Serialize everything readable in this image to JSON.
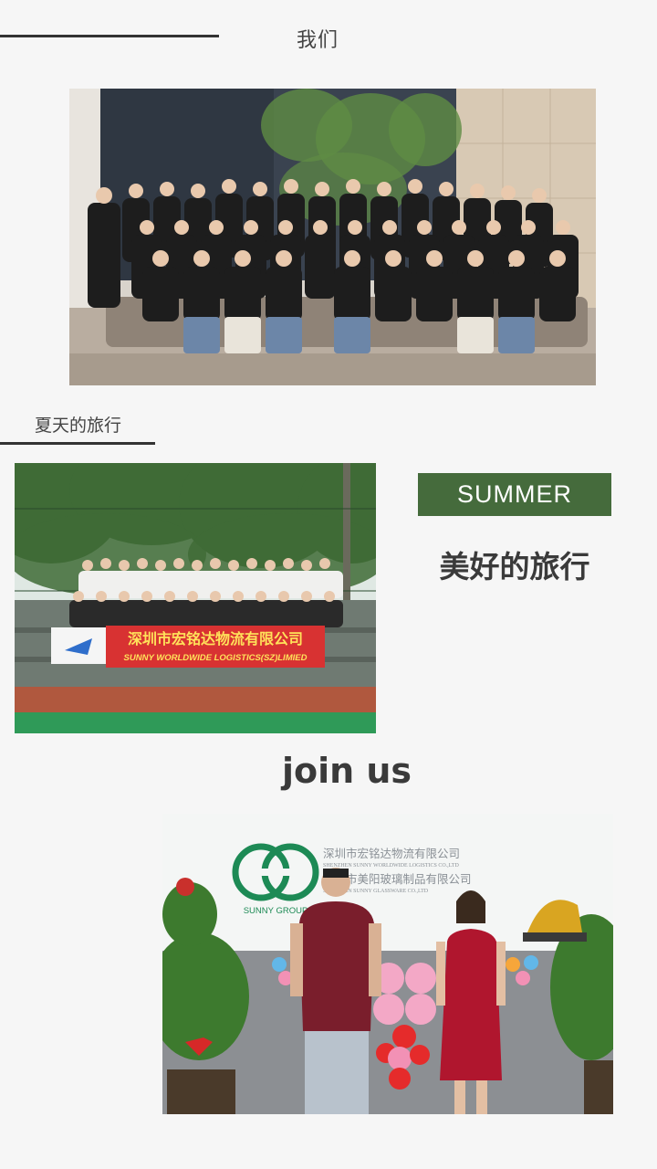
{
  "section_team": {
    "title": "我们"
  },
  "section_trip": {
    "title": "夏天的旅行",
    "badge": "SUMMER",
    "headline": "美好的旅行",
    "banner_cn": "深圳市宏铭达物流有限公司",
    "banner_en": "SUNNY WORLDWIDE LOGISTICS(SZ)LIMIED"
  },
  "section_join": {
    "title": "join us",
    "wall_company1_cn": "深圳市宏铭达物流有限公司",
    "wall_company1_en": "SHENZHEN SUNNY WORLDWIDE LOGISTICS CO.,LTD",
    "wall_company2_cn": "深圳市美阳玻璃制品有限公司",
    "wall_company2_en": "SHENZHEN SUNNY GLASSWARE CO.,LTD",
    "logo_text": "SUNNY GROUP"
  },
  "colors": {
    "accent_green": "#456b3c",
    "text_dark": "#3a3a3a",
    "background": "#f6f6f6"
  }
}
